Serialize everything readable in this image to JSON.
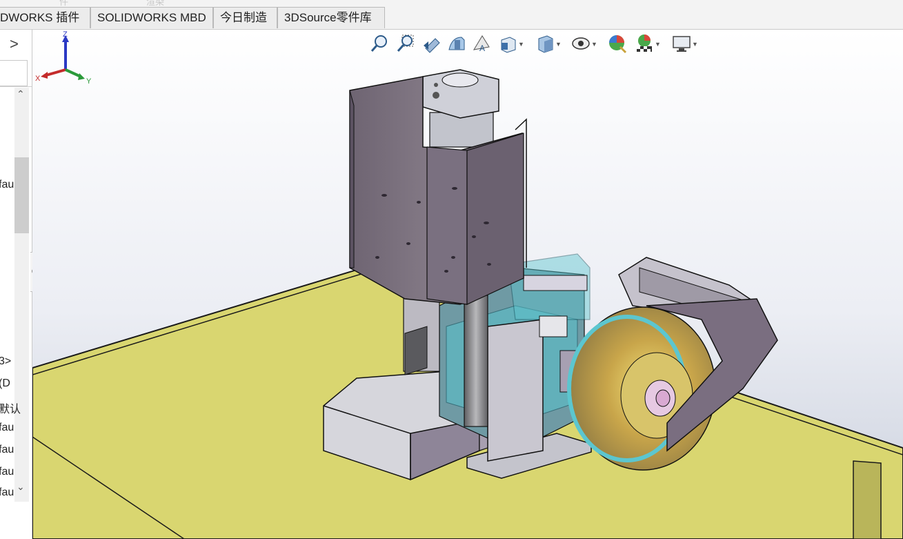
{
  "tabs": [
    {
      "label": "DWORKS 插件"
    },
    {
      "label": "SOLIDWORKS MBD"
    },
    {
      "label": "今日制造"
    },
    {
      "label": "3DSource零件库"
    }
  ],
  "tab_ghost_text": [
    "件",
    "渲染"
  ],
  "left_panel": {
    "expand_arrow": ">",
    "tree_fragments": [
      "fau",
      "3>",
      "(D",
      "默认",
      "fau",
      "fau",
      "fau",
      "fau"
    ]
  },
  "heads_up_toolbar": {
    "icons": [
      "zoom-to-fit-icon",
      "zoom-to-area-icon",
      "previous-view-icon",
      "section-view-icon",
      "dynamic-annotation-icon",
      "view-orientation-icon",
      "display-style-icon",
      "hide-show-items-icon",
      "edit-appearance-icon",
      "apply-scene-icon",
      "view-settings-icon"
    ]
  },
  "triad": {
    "x": "X",
    "y": "Y",
    "z": "Z"
  },
  "colors": {
    "viewport_top": "#ffffff",
    "viewport_bottom": "#c9cfdc",
    "table_yellow": "#d9d670",
    "sheet_metal": "#7d737f",
    "teal_plate": "#5cc6cf",
    "disc": "#c8b27a"
  }
}
